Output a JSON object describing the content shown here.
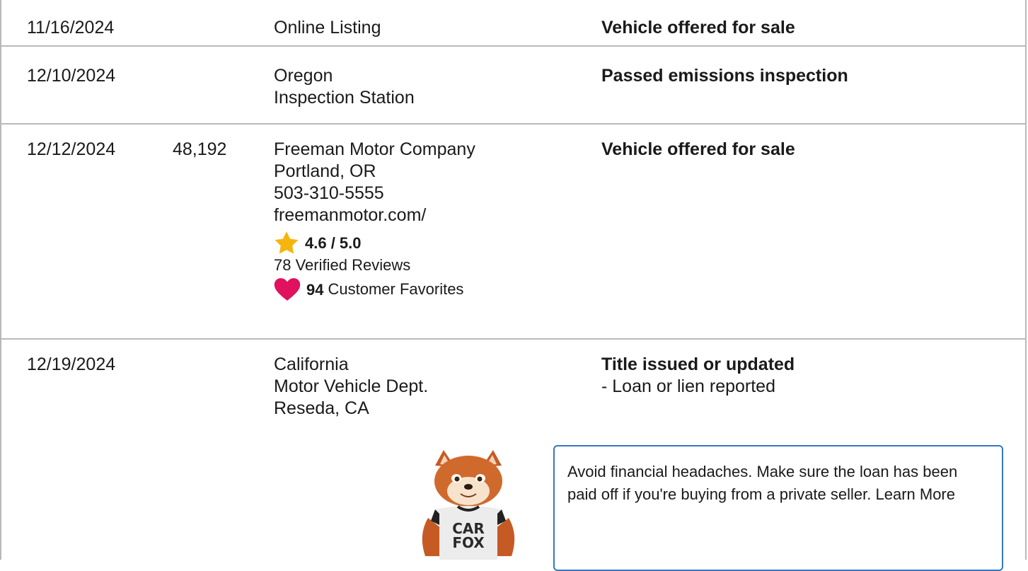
{
  "records": [
    {
      "date": "11/16/2024",
      "odometer": "",
      "source": [
        "Online Listing"
      ],
      "comment": "Vehicle offered for sale"
    },
    {
      "date": "12/10/2024",
      "odometer": "",
      "source": [
        "Oregon",
        "Inspection Station"
      ],
      "comment": "Passed emissions inspection"
    },
    {
      "date": "12/12/2024",
      "odometer": "48,192",
      "source": [
        "Freeman Motor Company",
        "Portland, OR",
        "503-310-5555",
        "freemanmotor.com/"
      ],
      "rating": "4.6 / 5.0",
      "reviews": "78 Verified Reviews",
      "favorites_count": "94",
      "favorites_label": "Customer Favorites",
      "comment": "Vehicle offered for sale"
    },
    {
      "date": "12/19/2024",
      "odometer": "",
      "source": [
        "California",
        "Motor Vehicle Dept.",
        "Reseda, CA"
      ],
      "comment": "Title issued or updated",
      "comment_detail": "- Loan or lien reported"
    }
  ],
  "tip": {
    "text": "Avoid financial headaches. Make sure the loan has been paid off if you're buying from a private seller.",
    "link": "Learn More"
  },
  "mascot": {
    "shirt_line1": "CAR",
    "shirt_line2": "FOX"
  },
  "colors": {
    "star": "#f6b40e",
    "heart": "#e0115f",
    "tip_border": "#3777bc",
    "row_border": "#b9b9b9"
  },
  "icons": [
    "star-icon",
    "heart-icon"
  ]
}
